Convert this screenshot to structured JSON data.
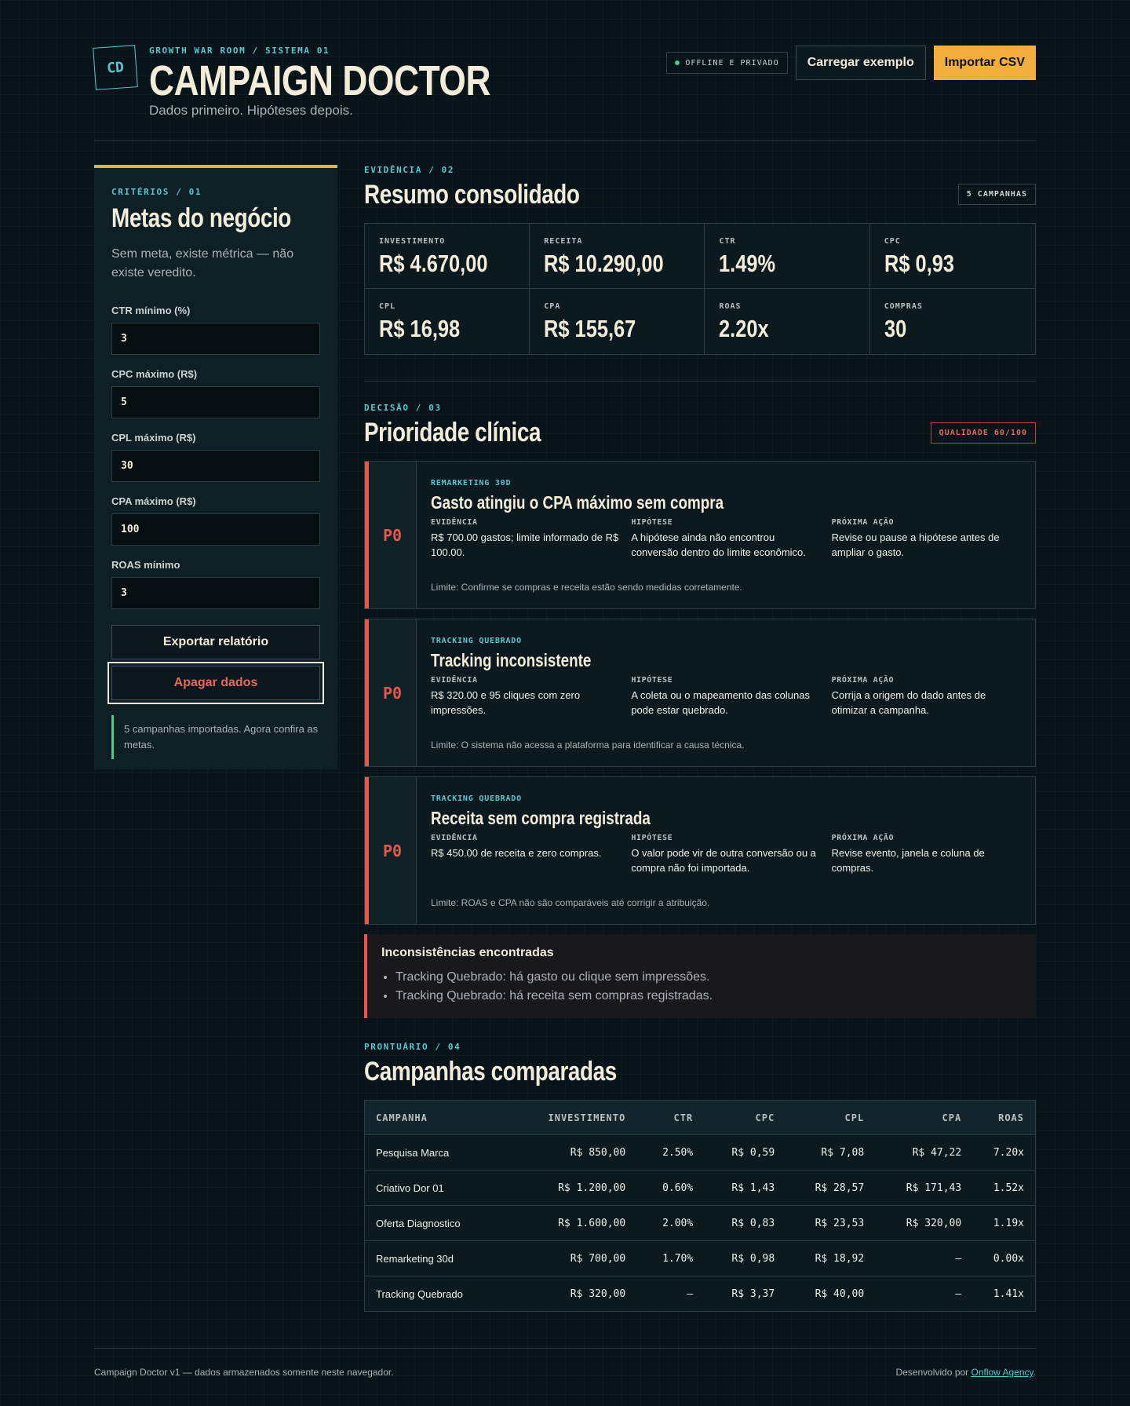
{
  "header": {
    "logo": "CD",
    "kicker": "GROWTH WAR ROOM / SISTEMA 01",
    "title": "CAMPAIGN DOCTOR",
    "tagline": "Dados primeiro. Hipóteses depois.",
    "offline_badge": "OFFLINE E PRIVADO",
    "load_example": "Carregar exemplo",
    "import_csv": "Importar CSV"
  },
  "sidebar": {
    "kicker": "CRITÉRIOS / 01",
    "title": "Metas do negócio",
    "lead": "Sem meta, existe métrica — não existe veredito.",
    "fields": [
      {
        "label": "CTR mínimo (%)",
        "value": "3"
      },
      {
        "label": "CPC máximo (R$)",
        "value": "5"
      },
      {
        "label": "CPL máximo (R$)",
        "value": "30"
      },
      {
        "label": "CPA máximo (R$)",
        "value": "100"
      },
      {
        "label": "ROAS mínimo",
        "value": "3"
      }
    ],
    "export_button": "Exportar relatório",
    "clear_button": "Apagar dados",
    "notice": "5 campanhas importadas. Agora confira as metas."
  },
  "summary": {
    "kicker": "EVIDÊNCIA / 02",
    "title": "Resumo consolidado",
    "badge": "5 CAMPANHAS",
    "kpis": [
      {
        "label": "INVESTIMENTO",
        "value": "R$  4.670,00"
      },
      {
        "label": "RECEITA",
        "value": "R$  10.290,00"
      },
      {
        "label": "CTR",
        "value": "1.49%"
      },
      {
        "label": "CPC",
        "value": "R$  0,93"
      },
      {
        "label": "CPL",
        "value": "R$  16,98"
      },
      {
        "label": "CPA",
        "value": "R$  155,67"
      },
      {
        "label": "ROAS",
        "value": "2.20x"
      },
      {
        "label": "COMPRAS",
        "value": "30"
      }
    ]
  },
  "priority": {
    "kicker": "DECISÃO / 03",
    "title": "Prioridade clínica",
    "badge": "QUALIDADE 60/100",
    "col_labels": {
      "evidence": "EVIDÊNCIA",
      "hypothesis": "HIPÓTESE",
      "action": "PRÓXIMA AÇÃO"
    },
    "cards": [
      {
        "priority": "P0",
        "category": "REMARKETING 30D",
        "title": "Gasto atingiu o CPA máximo sem compra",
        "evidence": "R$ 700.00 gastos; limite informado de R$ 100.00.",
        "hypothesis": "A hipótese ainda não encontrou conversão dentro do limite econômico.",
        "action": "Revise ou pause a hipótese antes de ampliar o gasto.",
        "limit": "Limite: Confirme se compras e receita estão sendo medidas corretamente."
      },
      {
        "priority": "P0",
        "category": "TRACKING QUEBRADO",
        "title": "Tracking inconsistente",
        "evidence": "R$ 320.00 e 95 cliques com zero impressões.",
        "hypothesis": "A coleta ou o mapeamento das colunas pode estar quebrado.",
        "action": "Corrija a origem do dado antes de otimizar a campanha.",
        "limit": "Limite: O sistema não acessa a plataforma para identificar a causa técnica."
      },
      {
        "priority": "P0",
        "category": "TRACKING QUEBRADO",
        "title": "Receita sem compra registrada",
        "evidence": "R$ 450.00 de receita e zero compras.",
        "hypothesis": "O valor pode vir de outra conversão ou a compra não foi importada.",
        "action": "Revise evento, janela e coluna de compras.",
        "limit": "Limite: ROAS e CPA não são comparáveis até corrigir a atribuição."
      }
    ],
    "inconsistencies": {
      "title": "Inconsistências encontradas",
      "items": [
        "Tracking Quebrado: há gasto ou clique sem impressões.",
        "Tracking Quebrado: há receita sem compras registradas."
      ]
    }
  },
  "campaigns": {
    "kicker": "PRONTUÁRIO / 04",
    "title": "Campanhas comparadas",
    "columns": [
      "CAMPANHA",
      "INVESTIMENTO",
      "CTR",
      "CPC",
      "CPL",
      "CPA",
      "ROAS"
    ],
    "rows": [
      [
        "Pesquisa Marca",
        "R$ 850,00",
        "2.50%",
        "R$ 0,59",
        "R$ 7,08",
        "R$ 47,22",
        "7.20x"
      ],
      [
        "Criativo Dor 01",
        "R$ 1.200,00",
        "0.60%",
        "R$ 1,43",
        "R$ 28,57",
        "R$ 171,43",
        "1.52x"
      ],
      [
        "Oferta Diagnostico",
        "R$ 1.600,00",
        "2.00%",
        "R$ 0,83",
        "R$ 23,53",
        "R$ 320,00",
        "1.19x"
      ],
      [
        "Remarketing 30d",
        "R$ 700,00",
        "1.70%",
        "R$ 0,98",
        "R$ 18,92",
        "—",
        "0.00x"
      ],
      [
        "Tracking Quebrado",
        "R$ 320,00",
        "—",
        "R$ 3,37",
        "R$ 40,00",
        "—",
        "1.41x"
      ]
    ]
  },
  "footer": {
    "left": "Campaign Doctor v1 — dados armazenados somente neste navegador.",
    "right_prefix": "Desenvolvido por ",
    "link": "Onflow Agency",
    "right_suffix": "."
  }
}
